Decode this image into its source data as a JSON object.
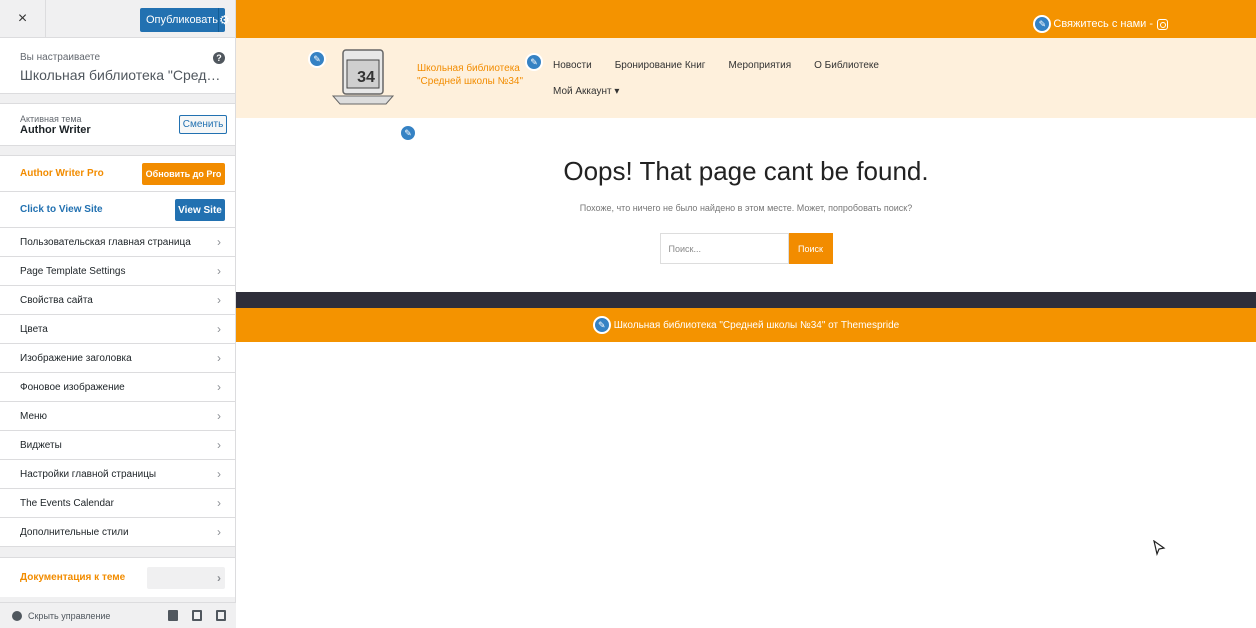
{
  "sidebar": {
    "close_label": "×",
    "publish_label": "Опубликовать",
    "customizing_small": "Вы настраиваете",
    "customizing_site": "Школьная библиотека \"Средней ш...",
    "help": "?",
    "active_theme_small": "Активная тема",
    "active_theme_name": "Author Writer",
    "change_label": "Сменить",
    "pro_row_label": "Author Writer Pro",
    "pro_button_label": "Обновить до Pro",
    "view_row_label": "Click to View Site",
    "view_button_label": "View Site",
    "items": [
      {
        "label": "Пользовательская главная страница"
      },
      {
        "label": "Page Template Settings"
      },
      {
        "label": "Свойства сайта"
      },
      {
        "label": "Цвета"
      },
      {
        "label": "Изображение заголовка"
      },
      {
        "label": "Фоновое изображение"
      },
      {
        "label": "Меню"
      },
      {
        "label": "Виджеты"
      },
      {
        "label": "Настройки главной страницы"
      },
      {
        "label": "The Events Calendar"
      },
      {
        "label": "Дополнительные стили"
      }
    ],
    "doc_label": "Документация к теме",
    "hide_label": "Скрыть управление"
  },
  "preview": {
    "contact_label": "Свяжитесь с нами -",
    "site_title": "Школьная библиотека \"Средней школы №34\"",
    "logo_number": "34",
    "nav": [
      "Новости",
      "Бронирование Книг",
      "Мероприятия",
      "О Библиотеке"
    ],
    "account_label": "Мой Аккаунт ▾",
    "heading": "Oops! That page cant be found.",
    "description": "Похоже, что ничего не было найдено в этом месте. Может, попробовать поиск?",
    "search_placeholder": "Поиск...",
    "search_button": "Поиск",
    "footer_text": "Школьная библиотека \"Средней школы №34\" от Themespride"
  },
  "colors": {
    "accent_orange": "#f49300",
    "wp_blue": "#2271b1",
    "footer_dark": "#2e2e3a",
    "header_bg": "#fef0dc"
  }
}
